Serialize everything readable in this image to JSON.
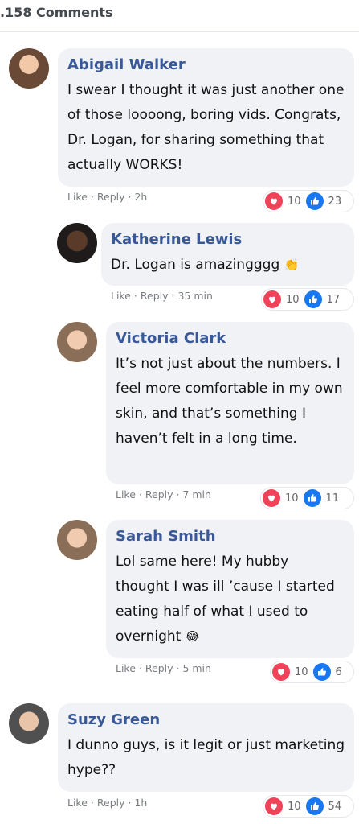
{
  "header": {
    "title": ".158 Comments"
  },
  "actions": {
    "like": "Like",
    "reply": "Reply",
    "sep": "·"
  },
  "comments": [
    {
      "name": "Abigail Walker",
      "text": "I swear I thought it was just another one of those loooong, boring vids. Congrats, Dr. Logan, for sharing something that actually WORKS!",
      "time": "2h",
      "hearts": "10",
      "likes": "23"
    },
    {
      "name": "Katherine Lewis",
      "text": "Dr. Logan is amazingggg",
      "emoji": "👏",
      "time": "35 min",
      "hearts": "10",
      "likes": "17"
    },
    {
      "name": "Victoria Clark",
      "text": "It’s not just about the numbers. I feel more comfortable in my own skin, and that’s something I haven’t felt in a long time.",
      "time": "7 min",
      "hearts": "10",
      "likes": "11"
    },
    {
      "name": "Sarah Smith",
      "text": "Lol same here! My hubby thought I was ill ’cause I started eating half of what I used to overnight",
      "emoji": "😂",
      "time": "5 min",
      "hearts": "10",
      "likes": "6"
    },
    {
      "name": "Suzy Green",
      "text": "I dunno guys, is it legit or just marketing hype??",
      "time": "1h",
      "hearts": "10",
      "likes": "54"
    }
  ]
}
